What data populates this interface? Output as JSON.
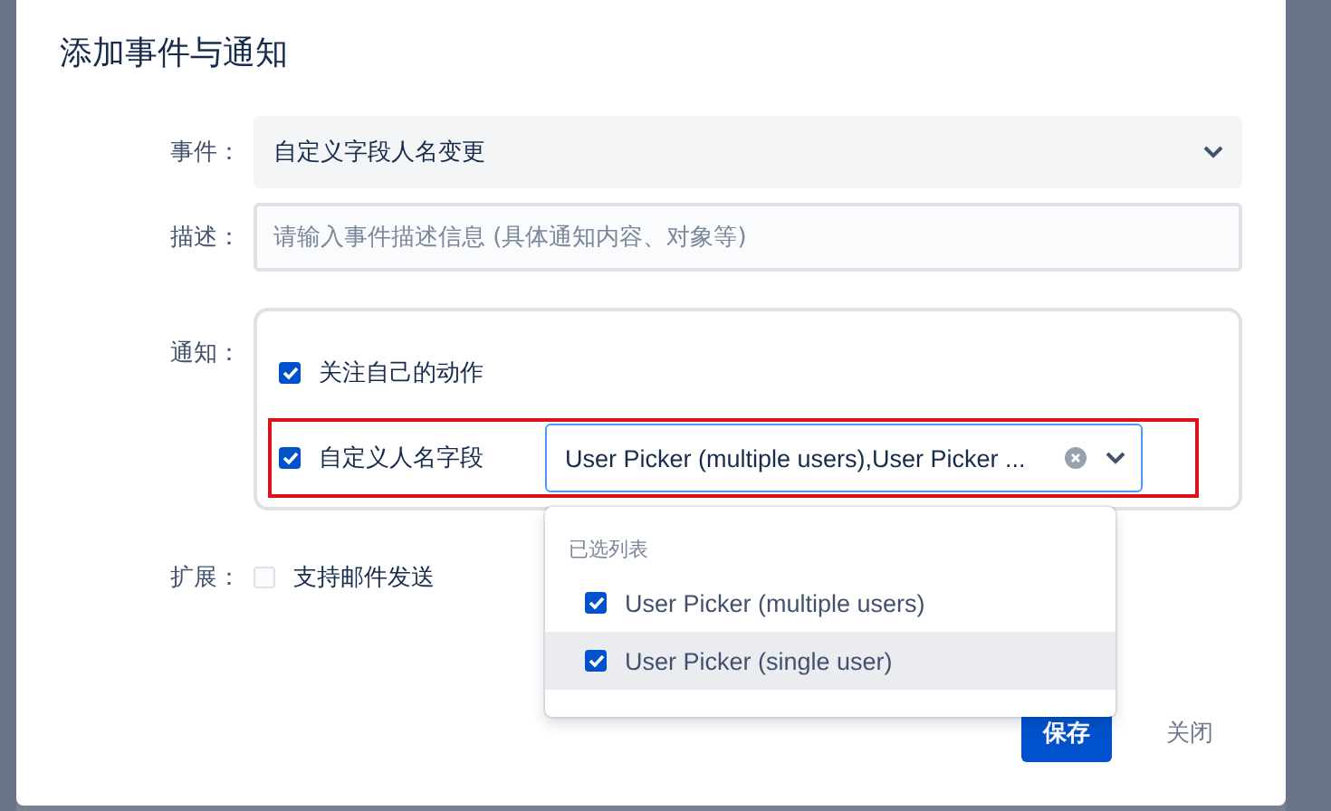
{
  "dialog": {
    "title": "添加事件与通知",
    "event": {
      "label": "事件：",
      "value": "自定义字段人名变更"
    },
    "description": {
      "label": "描述：",
      "placeholder": "请输入事件描述信息 (具体通知内容、对象等)"
    },
    "notify": {
      "label": "通知：",
      "options": [
        {
          "kind": "plain",
          "label": "关注自己的动作",
          "checked": true
        },
        {
          "kind": "picker",
          "label": "自定义人名字段",
          "checked": true,
          "highlighted": true,
          "picker_value": "User Picker (multiple users),User Picker ...",
          "dropdown": {
            "heading": "已选列表",
            "items": [
              {
                "label": "User Picker (multiple users)",
                "checked": true,
                "selected": false
              },
              {
                "label": "User Picker (single user)",
                "checked": true,
                "selected": true
              }
            ]
          }
        }
      ]
    },
    "extend": {
      "label": "扩展：",
      "option": {
        "label": "支持邮件发送",
        "checked": false
      }
    },
    "buttons": [
      {
        "kind": "primary",
        "label": "保存"
      },
      {
        "kind": "link",
        "label": "关闭"
      }
    ]
  }
}
